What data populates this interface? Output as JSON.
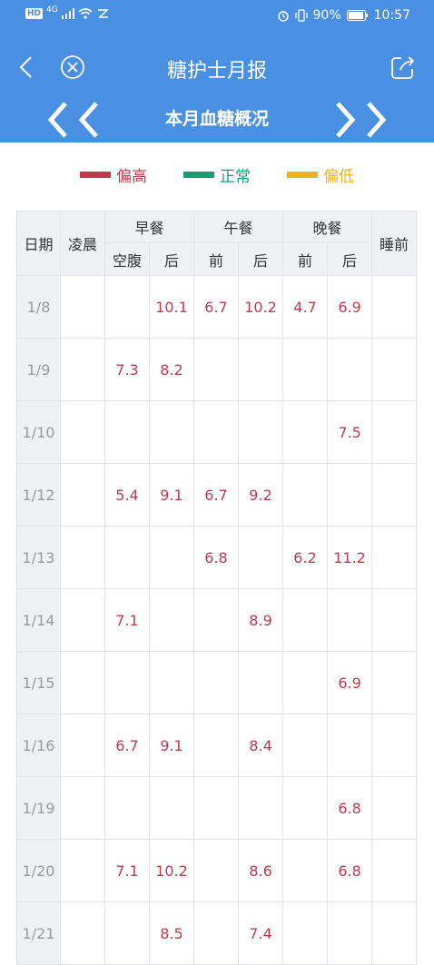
{
  "status_bar": {
    "hd": "HD",
    "network": "4G",
    "battery": "90%",
    "time": "10:57"
  },
  "header": {
    "title": "糖护士月报",
    "back_icon": "chevron-left-icon",
    "close_icon": "close-circle-icon",
    "share_icon": "share-icon"
  },
  "month_nav": {
    "title": "本月血糖概况",
    "prev_icon": "double-chevron-left-icon",
    "next_icon": "double-chevron-right-icon"
  },
  "legend": [
    {
      "label": "偏高",
      "color": "#c0394b"
    },
    {
      "label": "正常",
      "color": "#14a06e"
    },
    {
      "label": "偏低",
      "color": "#f0b21a"
    }
  ],
  "table": {
    "headers": {
      "date": "日期",
      "dawn": "凌晨",
      "breakfast": "早餐",
      "lunch": "午餐",
      "dinner": "晚餐",
      "bedtime": "睡前",
      "fasting": "空腹",
      "after": "后",
      "before": "前"
    },
    "high_color": "#c0394b",
    "rows": [
      {
        "date": "1/8",
        "dawn": "",
        "fasting": "",
        "bf_after": "10.1",
        "lunch_before": "6.7",
        "lunch_after": "10.2",
        "dinner_before": "4.7",
        "dinner_after": "6.9",
        "bedtime": ""
      },
      {
        "date": "1/9",
        "dawn": "",
        "fasting": "7.3",
        "bf_after": "8.2",
        "lunch_before": "",
        "lunch_after": "",
        "dinner_before": "",
        "dinner_after": "",
        "bedtime": ""
      },
      {
        "date": "1/10",
        "dawn": "",
        "fasting": "",
        "bf_after": "",
        "lunch_before": "",
        "lunch_after": "",
        "dinner_before": "",
        "dinner_after": "7.5",
        "bedtime": ""
      },
      {
        "date": "1/12",
        "dawn": "",
        "fasting": "5.4",
        "bf_after": "9.1",
        "lunch_before": "6.7",
        "lunch_after": "9.2",
        "dinner_before": "",
        "dinner_after": "",
        "bedtime": ""
      },
      {
        "date": "1/13",
        "dawn": "",
        "fasting": "",
        "bf_after": "",
        "lunch_before": "6.8",
        "lunch_after": "",
        "dinner_before": "6.2",
        "dinner_after": "11.2",
        "bedtime": ""
      },
      {
        "date": "1/14",
        "dawn": "",
        "fasting": "7.1",
        "bf_after": "",
        "lunch_before": "",
        "lunch_after": "8.9",
        "dinner_before": "",
        "dinner_after": "",
        "bedtime": ""
      },
      {
        "date": "1/15",
        "dawn": "",
        "fasting": "",
        "bf_after": "",
        "lunch_before": "",
        "lunch_after": "",
        "dinner_before": "",
        "dinner_after": "6.9",
        "bedtime": ""
      },
      {
        "date": "1/16",
        "dawn": "",
        "fasting": "6.7",
        "bf_after": "9.1",
        "lunch_before": "",
        "lunch_after": "8.4",
        "dinner_before": "",
        "dinner_after": "",
        "bedtime": ""
      },
      {
        "date": "1/19",
        "dawn": "",
        "fasting": "",
        "bf_after": "",
        "lunch_before": "",
        "lunch_after": "",
        "dinner_before": "",
        "dinner_after": "6.8",
        "bedtime": ""
      },
      {
        "date": "1/20",
        "dawn": "",
        "fasting": "7.1",
        "bf_after": "10.2",
        "lunch_before": "",
        "lunch_after": "8.6",
        "dinner_before": "",
        "dinner_after": "6.8",
        "bedtime": ""
      },
      {
        "date": "1/21",
        "dawn": "",
        "fasting": "",
        "bf_after": "8.5",
        "lunch_before": "",
        "lunch_after": "7.4",
        "dinner_before": "",
        "dinner_after": "",
        "bedtime": ""
      }
    ]
  }
}
